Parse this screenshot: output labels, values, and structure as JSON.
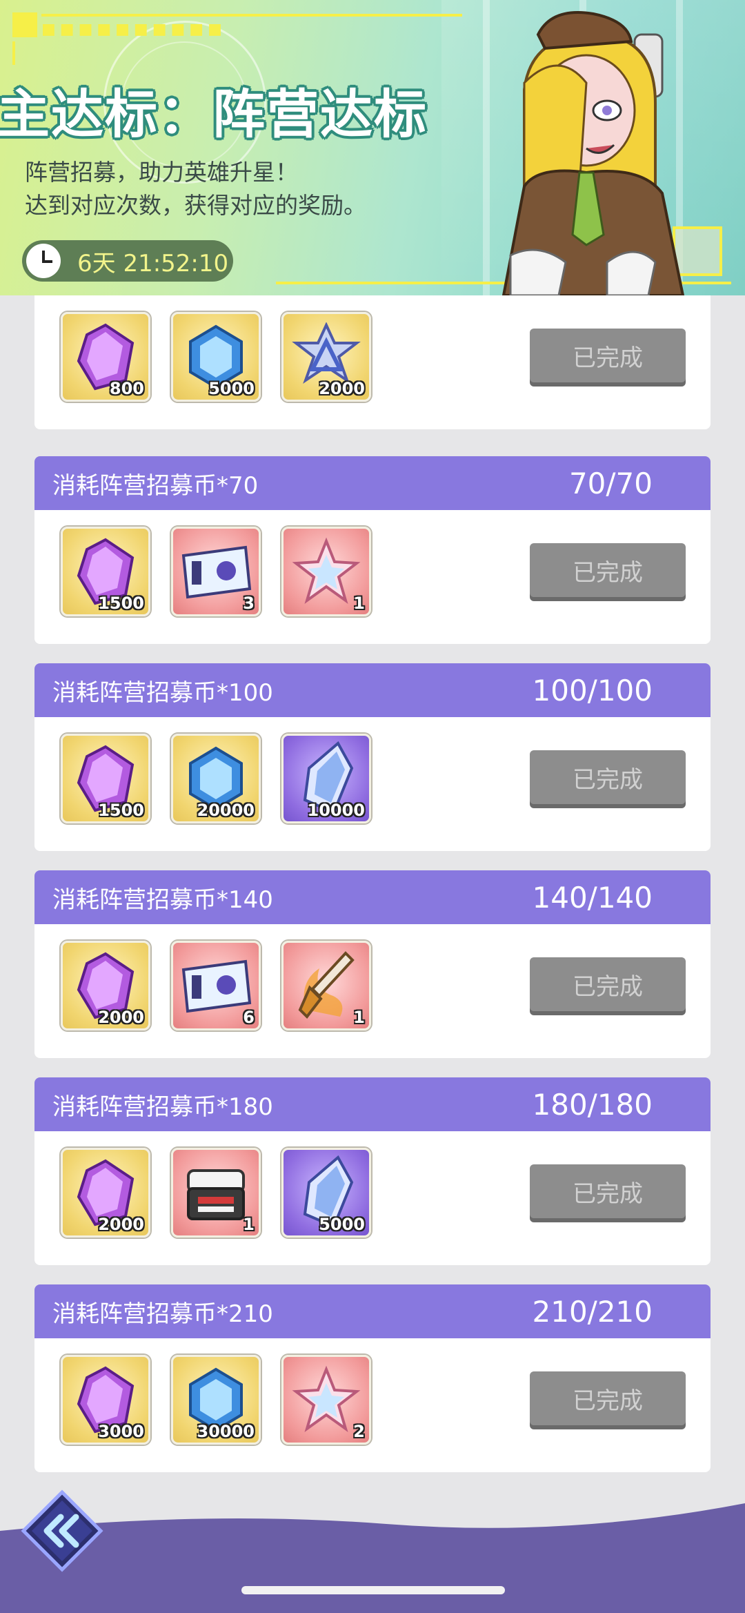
{
  "banner": {
    "title": "主达标：阵营达标",
    "desc_line1": "阵营招募，助力英雄升星！",
    "desc_line2": "达到对应次数，获得对应的奖励。",
    "timer": "6天 21:52:10"
  },
  "tiers": [
    {
      "title": "",
      "progress": "",
      "button": "已完成",
      "rewards": [
        {
          "icon": "purple-gem-icon",
          "bg": "gold",
          "count": "800"
        },
        {
          "icon": "blue-hexagon-gem-icon",
          "bg": "gold",
          "count": "5000"
        },
        {
          "icon": "crystal-star-badge-icon",
          "bg": "gold",
          "count": "2000"
        }
      ]
    },
    {
      "title": "消耗阵营招募币*70",
      "progress": "70/70",
      "button": "已完成",
      "rewards": [
        {
          "icon": "purple-gem-icon",
          "bg": "gold",
          "count": "1500"
        },
        {
          "icon": "recruit-ticket-icon",
          "bg": "pink",
          "count": "3"
        },
        {
          "icon": "pink-star-crystal-icon",
          "bg": "pink",
          "count": "1"
        }
      ]
    },
    {
      "title": "消耗阵营招募币*100",
      "progress": "100/100",
      "button": "已完成",
      "rewards": [
        {
          "icon": "purple-gem-icon",
          "bg": "gold",
          "count": "1500"
        },
        {
          "icon": "blue-hexagon-gem-icon",
          "bg": "gold",
          "count": "20000"
        },
        {
          "icon": "blue-crystal-shard-icon",
          "bg": "purple",
          "count": "10000"
        }
      ]
    },
    {
      "title": "消耗阵营招募币*140",
      "progress": "140/140",
      "button": "已完成",
      "rewards": [
        {
          "icon": "purple-gem-icon",
          "bg": "gold",
          "count": "2000"
        },
        {
          "icon": "recruit-ticket-icon",
          "bg": "pink",
          "count": "6"
        },
        {
          "icon": "flaming-dagger-icon",
          "bg": "pink",
          "count": "1"
        }
      ]
    },
    {
      "title": "消耗阵营招募币*180",
      "progress": "180/180",
      "button": "已完成",
      "rewards": [
        {
          "icon": "purple-gem-icon",
          "bg": "gold",
          "count": "2000"
        },
        {
          "icon": "supply-chest-icon",
          "bg": "pink",
          "count": "1"
        },
        {
          "icon": "blue-crystal-shard-icon",
          "bg": "purple",
          "count": "5000"
        }
      ]
    },
    {
      "title": "消耗阵营招募币*210",
      "progress": "210/210",
      "button": "已完成",
      "rewards": [
        {
          "icon": "purple-gem-icon",
          "bg": "gold",
          "count": "3000"
        },
        {
          "icon": "blue-hexagon-gem-icon",
          "bg": "gold",
          "count": "30000"
        },
        {
          "icon": "pink-star-crystal-icon",
          "bg": "pink",
          "count": "2"
        }
      ]
    }
  ],
  "colors": {
    "header_purple": "#8878df",
    "footer_purple": "#6a5ea6",
    "button_gray": "#8d8d8d",
    "title_outline": "#2f8d7d",
    "timer_text": "#f2f48b"
  }
}
